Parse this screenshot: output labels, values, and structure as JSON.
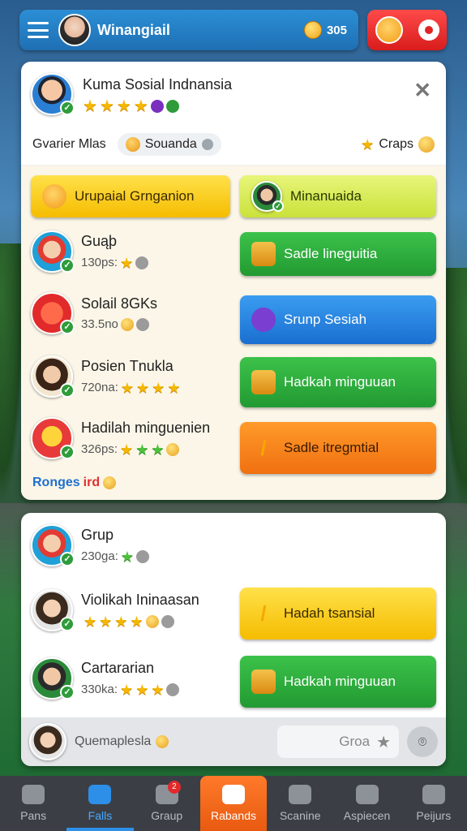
{
  "topbar": {
    "title": "Winangiail",
    "coins": "305"
  },
  "card1": {
    "header": {
      "name": "Kuma Sosial Indnansia"
    },
    "sub": {
      "left_label": "Gvarier Mlas",
      "pill": "Souanda",
      "right_label": "Craps"
    },
    "big_buttons": [
      {
        "label": "Urupaial Grnganion"
      },
      {
        "label": "Minanuaida"
      }
    ],
    "rows": [
      {
        "name": "Guąþ",
        "meta": "130ps:"
      },
      {
        "name": "Solail 8GKs",
        "meta": "33.5no"
      },
      {
        "name": "Posien Tnukla",
        "meta": "720na:"
      },
      {
        "name": "Hadilah minguenien",
        "meta": "326ps:"
      }
    ],
    "buttons": [
      {
        "label": "Sadle lineguitia"
      },
      {
        "label": "Srunp Sesiah"
      },
      {
        "label": "Hadkah minguuan"
      },
      {
        "label": "Sadle itregmtial"
      }
    ],
    "bottom_link": {
      "a": "Ronges",
      "b": "ird"
    }
  },
  "card2": {
    "rows": [
      {
        "name": "Grup",
        "meta": "230ga:"
      },
      {
        "name": "Violikah Ininaasan",
        "meta": ""
      },
      {
        "name": "Cartararian",
        "meta": "330ka:"
      }
    ],
    "buttons": [
      {
        "label": "Hadah tsansial"
      },
      {
        "label": "Hadkah minguuan"
      }
    ]
  },
  "input_bar": {
    "label": "Quemaplesla",
    "button": "Groa"
  },
  "nav": [
    {
      "label": "Pans"
    },
    {
      "label": "Falls"
    },
    {
      "label": "Graup",
      "badge": "2"
    },
    {
      "label": "Rabands"
    },
    {
      "label": "Scanine"
    },
    {
      "label": "Aspiecen"
    },
    {
      "label": "Peijurs"
    }
  ],
  "colors": {
    "primary_blue": "#1f6fb3",
    "accent_red": "#e02424",
    "nav_bg": "#3b3f45",
    "active_orange": "#f07010"
  }
}
